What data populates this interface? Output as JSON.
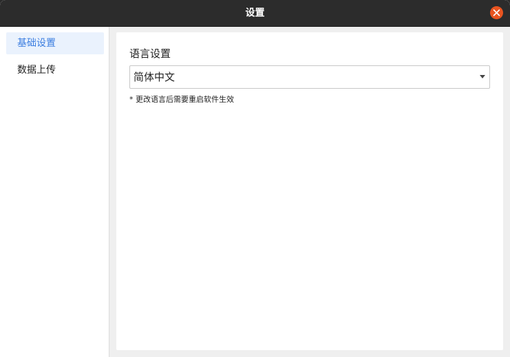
{
  "window": {
    "title": "设置"
  },
  "sidebar": {
    "items": [
      {
        "label": "基础设置",
        "active": true
      },
      {
        "label": "数据上传",
        "active": false
      }
    ]
  },
  "main": {
    "language": {
      "label": "语言设置",
      "selected": "简体中文",
      "hint": "* 更改语言后需要重启软件生效"
    }
  },
  "colors": {
    "titlebar": "#2c2c2c",
    "close_button": "#e95420",
    "accent": "#3b7de0",
    "active_item_bg": "#eaf2fd"
  }
}
